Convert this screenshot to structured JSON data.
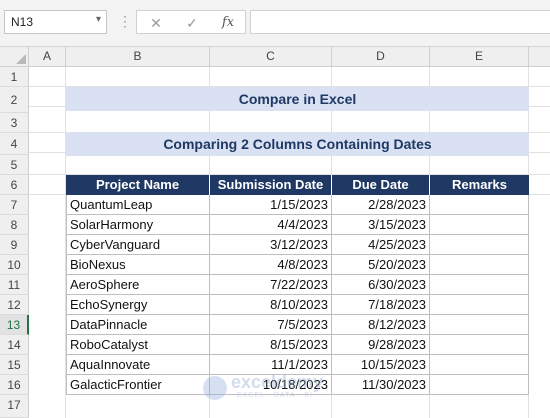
{
  "formula_bar": {
    "name_box": "N13",
    "dropdown_icon": "chevron-down-icon",
    "cancel_icon": "close-icon",
    "enter_icon": "check-icon",
    "function_label": "fx",
    "formula": ""
  },
  "columns": [
    "A",
    "B",
    "C",
    "D",
    "E"
  ],
  "rows": [
    "1",
    "2",
    "3",
    "4",
    "5",
    "6",
    "7",
    "8",
    "9",
    "10",
    "11",
    "12",
    "13",
    "14",
    "15",
    "16",
    "17"
  ],
  "active_row": "13",
  "title": "Compare in Excel",
  "subtitle": "Comparing 2 Columns Containing Dates",
  "table": {
    "headers": [
      "Project Name",
      "Submission Date",
      "Due Date",
      "Remarks"
    ],
    "rows": [
      [
        "QuantumLeap",
        "1/15/2023",
        "2/28/2023",
        ""
      ],
      [
        "SolarHarmony",
        "4/4/2023",
        "3/15/2023",
        ""
      ],
      [
        "CyberVanguard",
        "3/12/2023",
        "4/25/2023",
        ""
      ],
      [
        "BioNexus",
        "4/8/2023",
        "5/20/2023",
        ""
      ],
      [
        "AeroSphere",
        "7/22/2023",
        "6/30/2023",
        ""
      ],
      [
        "EchoSynergy",
        "8/10/2023",
        "7/18/2023",
        ""
      ],
      [
        "DataPinnacle",
        "7/5/2023",
        "8/12/2023",
        ""
      ],
      [
        "RoboCatalyst",
        "8/15/2023",
        "9/28/2023",
        ""
      ],
      [
        "AquaInnovate",
        "11/1/2023",
        "10/15/2023",
        ""
      ],
      [
        "GalacticFrontier",
        "10/18/2023",
        "11/30/2023",
        ""
      ]
    ]
  },
  "watermark": {
    "name": "exceldemy",
    "tagline": "EXCEL · DATA · BI"
  },
  "colors": {
    "header_fill": "#203864",
    "band_fill": "#d9e1f2",
    "band_text": "#1f3864",
    "active_row": "#217346"
  }
}
